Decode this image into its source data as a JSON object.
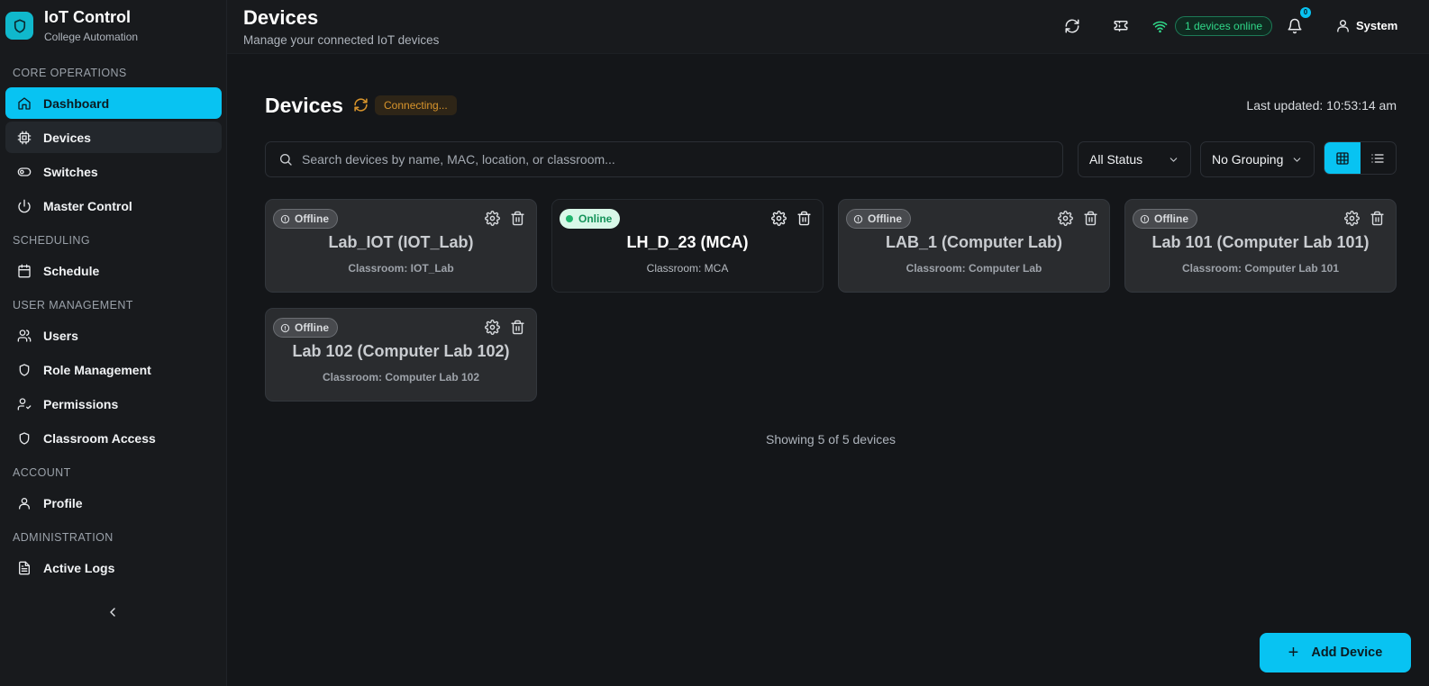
{
  "brand": {
    "title": "IoT Control",
    "subtitle": "College Automation"
  },
  "sidebar": {
    "sections": [
      {
        "label": "CORE OPERATIONS",
        "items": [
          {
            "label": "Dashboard",
            "icon": "home-icon",
            "active": true
          },
          {
            "label": "Devices",
            "icon": "chip-icon",
            "current": true
          },
          {
            "label": "Switches",
            "icon": "toggle-icon"
          },
          {
            "label": "Master Control",
            "icon": "power-icon"
          }
        ]
      },
      {
        "label": "SCHEDULING",
        "items": [
          {
            "label": "Schedule",
            "icon": "calendar-icon"
          }
        ]
      },
      {
        "label": "USER MANAGEMENT",
        "items": [
          {
            "label": "Users",
            "icon": "users-icon"
          },
          {
            "label": "Role Management",
            "icon": "shield-icon"
          },
          {
            "label": "Permissions",
            "icon": "user-check-icon"
          },
          {
            "label": "Classroom Access",
            "icon": "shield-icon"
          }
        ]
      },
      {
        "label": "ACCOUNT",
        "items": [
          {
            "label": "Profile",
            "icon": "user-icon"
          }
        ]
      },
      {
        "label": "ADMINISTRATION",
        "items": [
          {
            "label": "Active Logs",
            "icon": "file-text-icon"
          }
        ]
      }
    ]
  },
  "header": {
    "title": "Devices",
    "subtitle": "Manage your connected IoT devices",
    "online_text": "1 devices online",
    "notification_count": "0",
    "user_name": "System"
  },
  "main": {
    "title": "Devices",
    "connection_status": "Connecting...",
    "last_updated": "Last updated: 10:53:14 am",
    "search_placeholder": "Search devices by name, MAC, location, or classroom...",
    "status_filter": "All Status",
    "grouping": "No Grouping",
    "devices": [
      {
        "name": "Lab_IOT (IOT_Lab)",
        "classroom": "Classroom: IOT_Lab",
        "status": "Offline"
      },
      {
        "name": "LH_D_23 (MCA)",
        "classroom": "Classroom: MCA",
        "status": "Online"
      },
      {
        "name": "LAB_1 (Computer Lab)",
        "classroom": "Classroom: Computer Lab",
        "status": "Offline"
      },
      {
        "name": "Lab 101 (Computer Lab 101)",
        "classroom": "Classroom: Computer Lab 101",
        "status": "Offline"
      },
      {
        "name": "Lab 102 (Computer Lab 102)",
        "classroom": "Classroom: Computer Lab 102",
        "status": "Offline"
      }
    ],
    "showing_text": "Showing 5 of 5 devices",
    "add_button": "Add Device"
  },
  "colors": {
    "accent": "#08c3f2",
    "online": "#30d889",
    "warning": "#d9952c"
  }
}
